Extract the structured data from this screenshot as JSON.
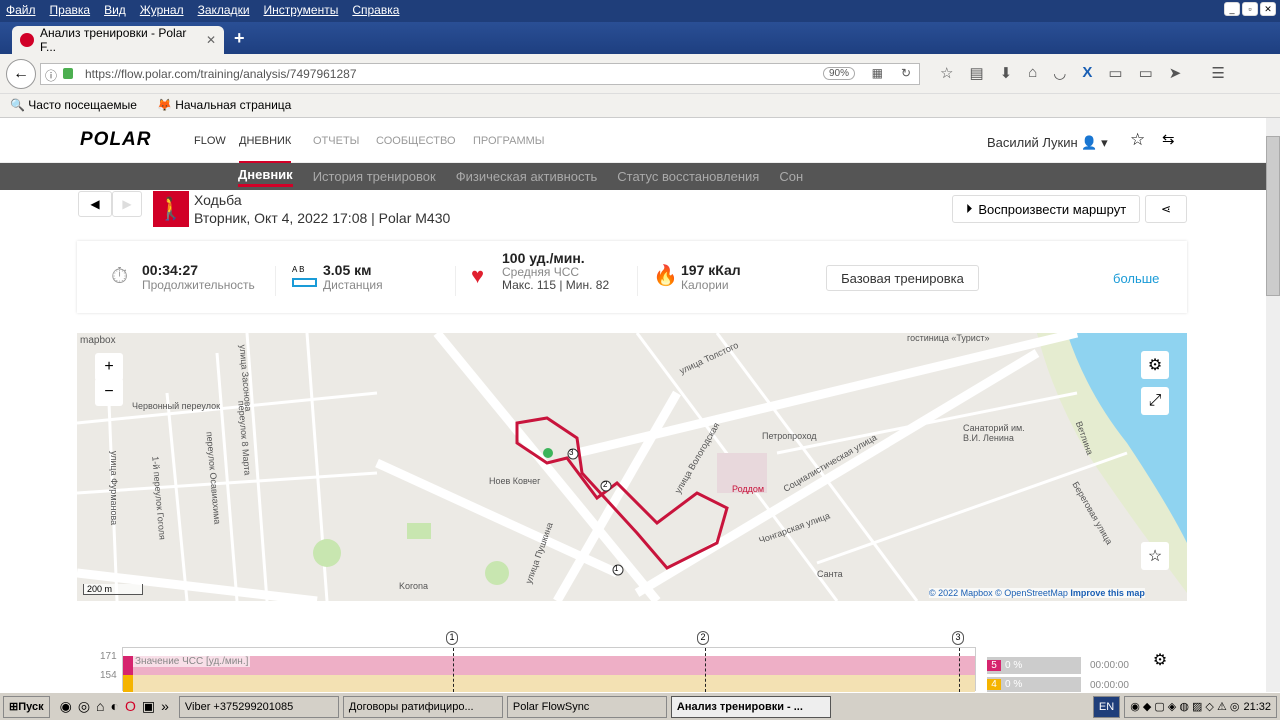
{
  "browser": {
    "menu": [
      "Файл",
      "Правка",
      "Вид",
      "Журнал",
      "Закладки",
      "Инструменты",
      "Справка"
    ],
    "tab_title": "Анализ тренировки - Polar F...",
    "url": "https://flow.polar.com/training/analysis/7497961287",
    "zoom": "90%",
    "bookmarks": [
      "Часто посещаемые",
      "Начальная страница"
    ]
  },
  "site": {
    "logo": "POLAR",
    "flow": "FLOW",
    "nav": [
      "ДНЕВНИК",
      "ОТЧЕТЫ",
      "СООБЩЕСТВО",
      "ПРОГРАММЫ"
    ],
    "user": "Василий Лукин",
    "subnav": [
      "Дневник",
      "История тренировок",
      "Физическая активность",
      "Статус восстановления",
      "Сон"
    ]
  },
  "training": {
    "sport": "Ходьба",
    "date": "Вторник, Окт 4, 2022 17:08 | Polar M430",
    "replay": "Воспроизвести маршрут"
  },
  "summary": {
    "duration": "00:34:27",
    "duration_label": "Продолжительность",
    "distance": "3.05 км",
    "distance_label": "Дистанция",
    "ab": "A  B",
    "hr": "100 уд./мин.",
    "hr_label": "Средняя ЧСС",
    "hr_range": "Макс. 115  |  Мин. 82",
    "calories": "197 кКал",
    "calories_label": "Калории",
    "base_btn": "Базовая тренировка",
    "more": "больше"
  },
  "map": {
    "brand": "mapbox",
    "scale": "200 m",
    "attribution": "© 2022 Mapbox © OpenStreetMap",
    "improve": "Improve this map",
    "labels": [
      "гостиница «Турист»",
      "улица Толстого",
      "Червонный переулок",
      "улица Фурманова",
      "1-й переулок Гоголя",
      "переулок Осавиахима",
      "переулок 8 Марта",
      "улица Засонова",
      "Петропроход",
      "Санаторий им. В.И. Ленина",
      "Социалистическая улица",
      "Роддом",
      "улица Вологодская",
      "Ноев Ковчег",
      "улица Пушкина",
      "Чонгарская улица",
      "Санта",
      "Korona",
      "Береговая улица",
      "Ветлина"
    ],
    "markers": [
      "1",
      "2",
      "3"
    ]
  },
  "chart": {
    "lap_markers": [
      "1",
      "2",
      "3"
    ],
    "y_ticks": [
      "171",
      "154"
    ],
    "series_label": "Значение ЧСС [уд./мин.]",
    "zones": [
      {
        "zone": "5",
        "pct": "0 %",
        "time": "00:00:00",
        "color": "#d6246e"
      },
      {
        "zone": "4",
        "pct": "0 %",
        "time": "00:00:00",
        "color": "#f5b400"
      }
    ]
  },
  "taskbar": {
    "start": "Пуск",
    "items": [
      "Viber +375299201085",
      "Договоры ратифициро...",
      "Polar FlowSync",
      "Анализ тренировки - ..."
    ],
    "lang": "EN",
    "time": "21:32"
  },
  "colors": {
    "accent": "#d10027",
    "route": "#c8143c",
    "link": "#1a9bd7"
  }
}
